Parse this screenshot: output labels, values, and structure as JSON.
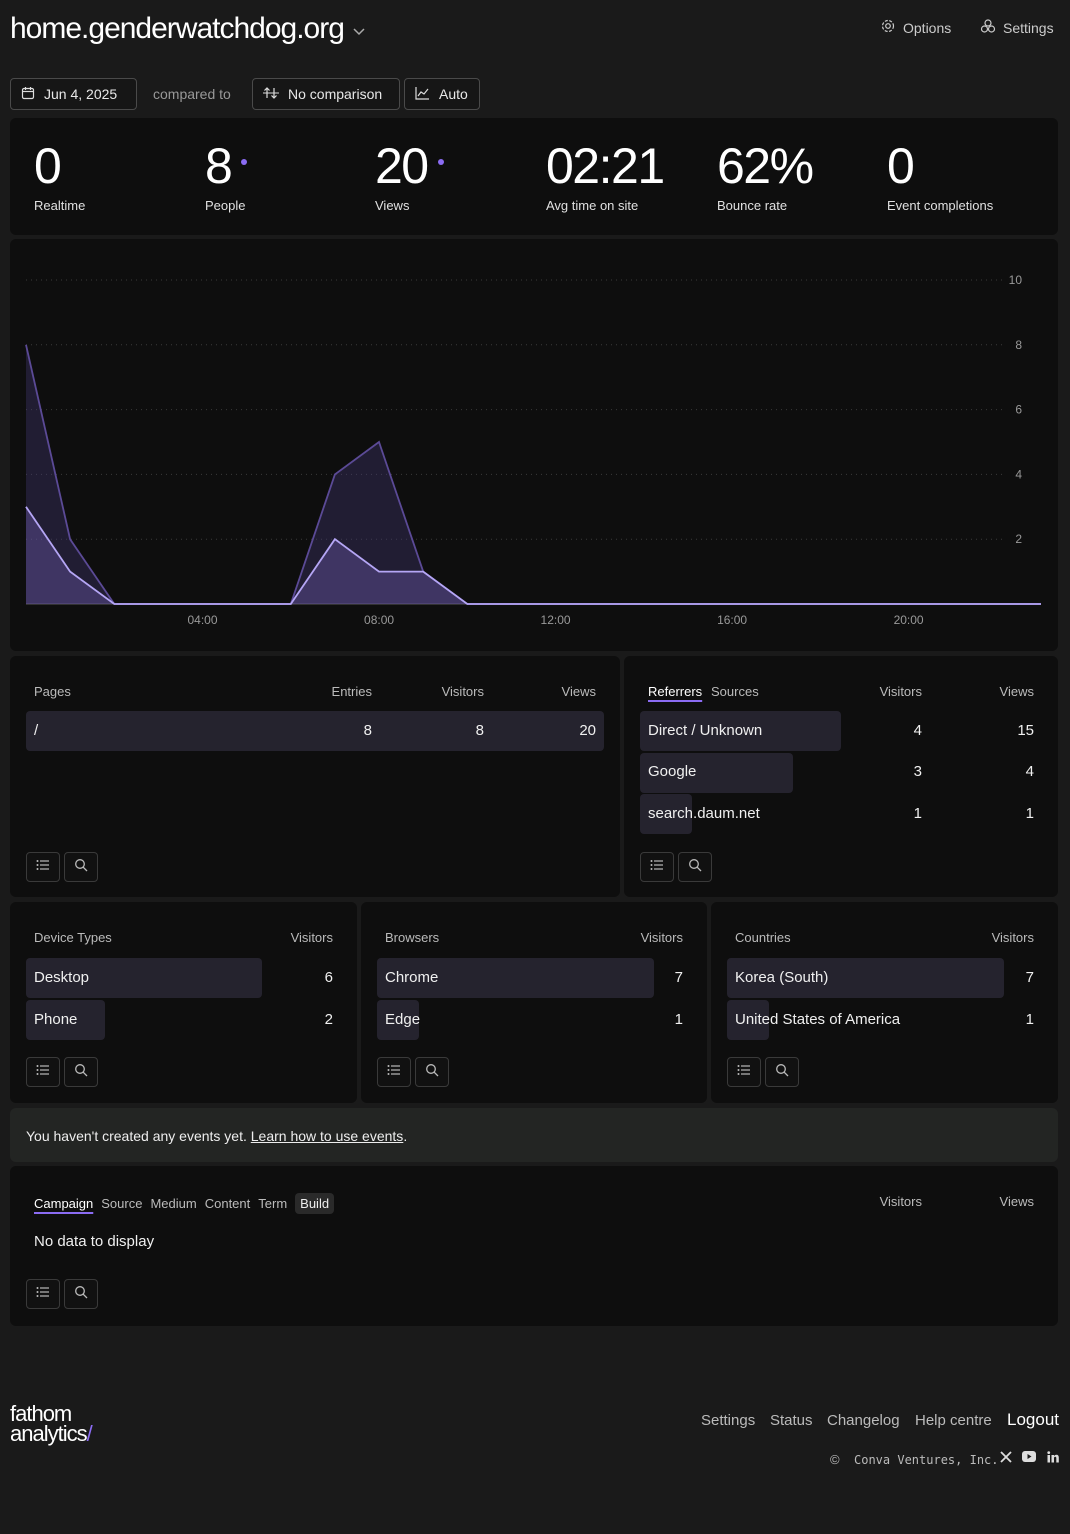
{
  "header": {
    "site_name": "home.genderwatchdog.org",
    "options_label": "Options",
    "settings_label": "Settings"
  },
  "toolbar": {
    "date_label": "Jun 4, 2025",
    "compared_to": "compared to",
    "comparison_label": "No comparison",
    "interval_label": "Auto"
  },
  "stats": [
    {
      "value": "0",
      "label": "Realtime"
    },
    {
      "value": "8",
      "label": "People"
    },
    {
      "value": "20",
      "label": "Views"
    },
    {
      "value": "02:21",
      "label": "Avg time on site"
    },
    {
      "value": "62%",
      "label": "Bounce rate"
    },
    {
      "value": "0",
      "label": "Event completions"
    }
  ],
  "chart_data": {
    "type": "area",
    "x_ticks": [
      "04:00",
      "08:00",
      "12:00",
      "16:00",
      "20:00"
    ],
    "y_ticks": [
      2,
      4,
      6,
      8,
      10
    ],
    "ylim": [
      0,
      10
    ],
    "x_hours": [
      0,
      1,
      2,
      3,
      4,
      5,
      6,
      7,
      8,
      9,
      10,
      11,
      12,
      13,
      14,
      15,
      16,
      17,
      18,
      19,
      20,
      21,
      22,
      23
    ],
    "series": [
      {
        "values": [
          8,
          2,
          0,
          0,
          0,
          0,
          0,
          4,
          5,
          1,
          0,
          0,
          0,
          0,
          0,
          0,
          0,
          0,
          0,
          0,
          0,
          0,
          0,
          0
        ]
      },
      {
        "values": [
          3,
          1,
          0,
          0,
          0,
          0,
          0,
          2,
          1,
          1,
          0,
          0,
          0,
          0,
          0,
          0,
          0,
          0,
          0,
          0,
          0,
          0,
          0,
          0
        ]
      }
    ],
    "colors": {
      "views": "#5b4a96",
      "people": "#b5a6f5"
    }
  },
  "pages": {
    "title": "Pages",
    "col_entries": "Entries",
    "col_visitors": "Visitors",
    "col_views": "Views",
    "rows": [
      {
        "path": "/",
        "entries": "8",
        "visitors": "8",
        "views": "20"
      }
    ]
  },
  "referrers": {
    "tab_referrers": "Referrers",
    "tab_sources": "Sources",
    "col_visitors": "Visitors",
    "col_views": "Views",
    "rows": [
      {
        "name": "Direct / Unknown",
        "visitors": "4",
        "views": "15"
      },
      {
        "name": "Google",
        "visitors": "3",
        "views": "4"
      },
      {
        "name": "search.daum.net",
        "visitors": "1",
        "views": "1"
      }
    ]
  },
  "devices": {
    "title": "Device Types",
    "col_visitors": "Visitors",
    "rows": [
      {
        "name": "Desktop",
        "visitors": "6"
      },
      {
        "name": "Phone",
        "visitors": "2"
      }
    ]
  },
  "browsers": {
    "title": "Browsers",
    "col_visitors": "Visitors",
    "rows": [
      {
        "name": "Chrome",
        "visitors": "7"
      },
      {
        "name": "Edge",
        "visitors": "1"
      }
    ]
  },
  "countries": {
    "title": "Countries",
    "col_visitors": "Visitors",
    "rows": [
      {
        "name": "Korea (South)",
        "visitors": "7"
      },
      {
        "name": "United States of America",
        "visitors": "1"
      }
    ]
  },
  "events_notice": {
    "text": "You haven't created any events yet. ",
    "link": "Learn how to use events",
    "suffix": "."
  },
  "utm": {
    "tabs": [
      "Campaign",
      "Source",
      "Medium",
      "Content",
      "Term",
      "Build"
    ],
    "col_visitors": "Visitors",
    "col_views": "Views",
    "empty": "No data to display"
  },
  "footer": {
    "logo_line1": "fathom",
    "logo_line2": "analytics",
    "logo_slash": "/",
    "links": [
      "Settings",
      "Status",
      "Changelog",
      "Help centre"
    ],
    "logout": "Logout",
    "copyright": "Conva Ventures, Inc.",
    "copyright_symbol": "©"
  }
}
